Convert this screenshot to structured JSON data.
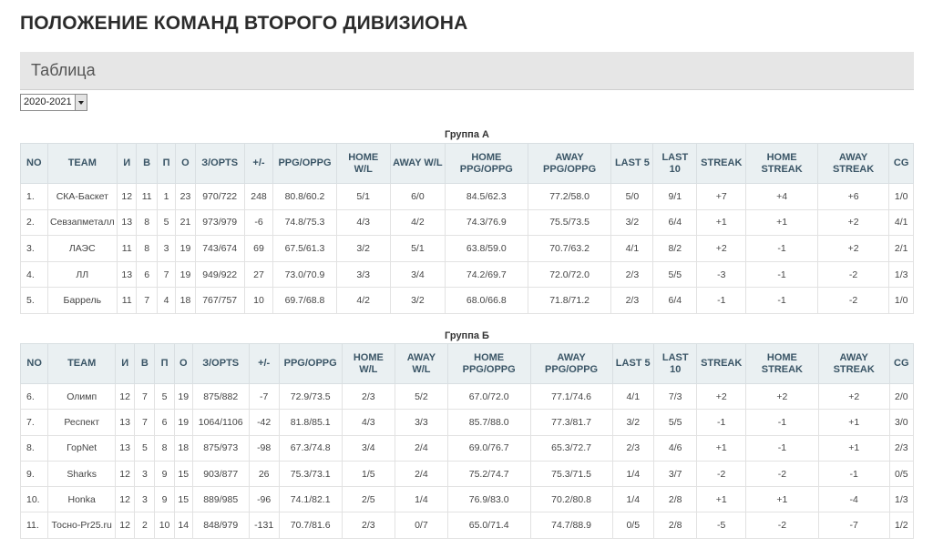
{
  "page": {
    "title": "ПОЛОЖЕНИЕ КОМАНД ВТОРОГО ДИВИЗИОНА"
  },
  "section": {
    "label": "Таблица"
  },
  "season_select": {
    "value": "2020-2021"
  },
  "columns": [
    "NO",
    "TEAM",
    "И",
    "В",
    "П",
    "О",
    "З/OPTS",
    "+/-",
    "PPG/OPPG",
    "HOME W/L",
    "AWAY W/L",
    "HOME PPG/OPPG",
    "AWAY PPG/OPPG",
    "LAST 5",
    "LAST 10",
    "STREAK",
    "HOME STREAK",
    "AWAY STREAK",
    "CG"
  ],
  "groups": [
    {
      "title": "Группа А",
      "rows": [
        [
          "1.",
          "СКА-Баскет",
          "12",
          "11",
          "1",
          "23",
          "970/722",
          "248",
          "80.8/60.2",
          "5/1",
          "6/0",
          "84.5/62.3",
          "77.2/58.0",
          "5/0",
          "9/1",
          "+7",
          "+4",
          "+6",
          "1/0"
        ],
        [
          "2.",
          "Севзапметалл",
          "13",
          "8",
          "5",
          "21",
          "973/979",
          "-6",
          "74.8/75.3",
          "4/3",
          "4/2",
          "74.3/76.9",
          "75.5/73.5",
          "3/2",
          "6/4",
          "+1",
          "+1",
          "+2",
          "4/1"
        ],
        [
          "3.",
          "ЛАЭС",
          "11",
          "8",
          "3",
          "19",
          "743/674",
          "69",
          "67.5/61.3",
          "3/2",
          "5/1",
          "63.8/59.0",
          "70.7/63.2",
          "4/1",
          "8/2",
          "+2",
          "-1",
          "+2",
          "2/1"
        ],
        [
          "4.",
          "ЛЛ",
          "13",
          "6",
          "7",
          "19",
          "949/922",
          "27",
          "73.0/70.9",
          "3/3",
          "3/4",
          "74.2/69.7",
          "72.0/72.0",
          "2/3",
          "5/5",
          "-3",
          "-1",
          "-2",
          "1/3"
        ],
        [
          "5.",
          "Баррель",
          "11",
          "7",
          "4",
          "18",
          "767/757",
          "10",
          "69.7/68.8",
          "4/2",
          "3/2",
          "68.0/66.8",
          "71.8/71.2",
          "2/3",
          "6/4",
          "-1",
          "-1",
          "-2",
          "1/0"
        ]
      ]
    },
    {
      "title": "Группа Б",
      "rows": [
        [
          "6.",
          "Олимп",
          "12",
          "7",
          "5",
          "19",
          "875/882",
          "-7",
          "72.9/73.5",
          "2/3",
          "5/2",
          "67.0/72.0",
          "77.1/74.6",
          "4/1",
          "7/3",
          "+2",
          "+2",
          "+2",
          "2/0"
        ],
        [
          "7.",
          "Респект",
          "13",
          "7",
          "6",
          "19",
          "1064/1106",
          "-42",
          "81.8/85.1",
          "4/3",
          "3/3",
          "85.7/88.0",
          "77.3/81.7",
          "3/2",
          "5/5",
          "-1",
          "-1",
          "+1",
          "3/0"
        ],
        [
          "8.",
          "ГорNet",
          "13",
          "5",
          "8",
          "18",
          "875/973",
          "-98",
          "67.3/74.8",
          "3/4",
          "2/4",
          "69.0/76.7",
          "65.3/72.7",
          "2/3",
          "4/6",
          "+1",
          "-1",
          "+1",
          "2/3"
        ],
        [
          "9.",
          "Sharks",
          "12",
          "3",
          "9",
          "15",
          "903/877",
          "26",
          "75.3/73.1",
          "1/5",
          "2/4",
          "75.2/74.7",
          "75.3/71.5",
          "1/4",
          "3/7",
          "-2",
          "-2",
          "-1",
          "0/5"
        ],
        [
          "10.",
          "Honka",
          "12",
          "3",
          "9",
          "15",
          "889/985",
          "-96",
          "74.1/82.1",
          "2/5",
          "1/4",
          "76.9/83.0",
          "70.2/80.8",
          "1/4",
          "2/8",
          "+1",
          "+1",
          "-4",
          "1/3"
        ],
        [
          "11.",
          "Тосно-Pr25.ru",
          "12",
          "2",
          "10",
          "14",
          "848/979",
          "-131",
          "70.7/81.6",
          "2/3",
          "0/7",
          "65.0/71.4",
          "74.7/88.9",
          "0/5",
          "2/8",
          "-5",
          "-2",
          "-7",
          "1/2"
        ]
      ]
    }
  ]
}
